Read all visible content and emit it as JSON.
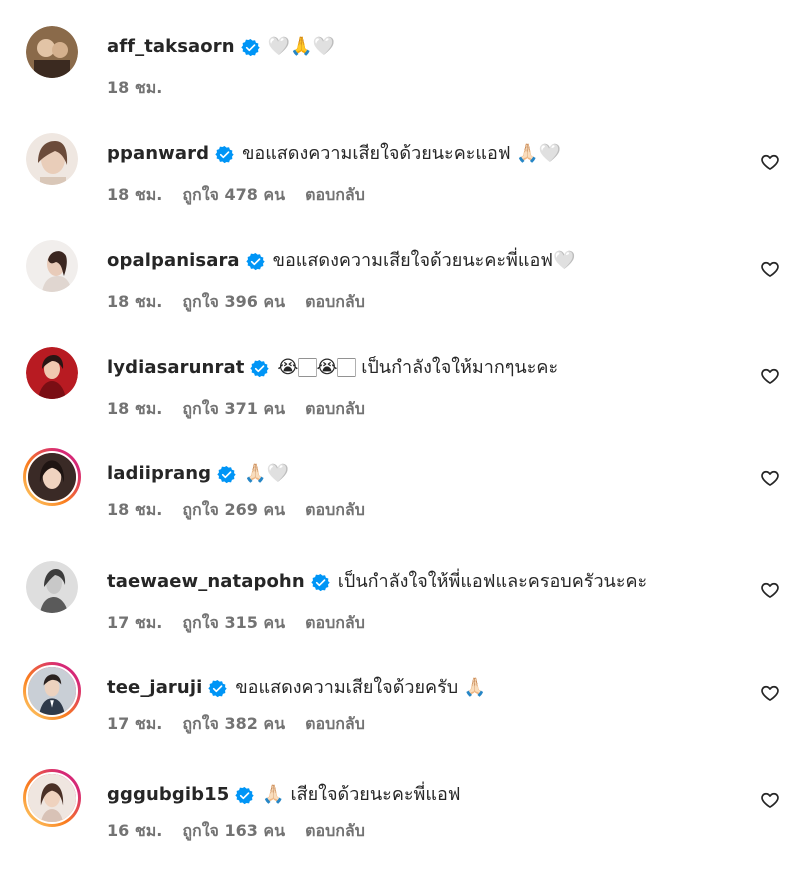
{
  "comments": [
    {
      "username": "aff_taksaorn",
      "text": "🤍🙏🤍",
      "time": "18 ชม.",
      "likes": "",
      "reply": "",
      "has_like_button": false,
      "story_ring": false,
      "avatar_color": "#8a6a4a"
    },
    {
      "username": "ppanward",
      "text": "ขอแสดงความเสียใจด้วยนะคะแอฟ 🙏🏻🤍",
      "time": "18 ชม.",
      "likes": "ถูกใจ 478 คน",
      "reply": "ตอบกลับ",
      "has_like_button": true,
      "story_ring": false,
      "avatar_color": "#d9c7b8"
    },
    {
      "username": "opalpanisara",
      "text": "ขอแสดงความเสียใจด้วยนะคะพี่แอฟ🤍",
      "time": "18 ชม.",
      "likes": "ถูกใจ 396 คน",
      "reply": "ตอบกลับ",
      "has_like_button": true,
      "story_ring": false,
      "avatar_color": "#e8e0dc"
    },
    {
      "username": "lydiasarunrat",
      "text": "😭🏻😭🏻 เป็นกำลังใจให้มากๆนะคะ",
      "time": "18 ชม.",
      "likes": "ถูกใจ 371 คน",
      "reply": "ตอบกลับ",
      "has_like_button": true,
      "story_ring": false,
      "avatar_color": "#b81b22"
    },
    {
      "username": "ladiiprang",
      "text": "🙏🏻🤍",
      "time": "18 ชม.",
      "likes": "ถูกใจ 269 คน",
      "reply": "ตอบกลับ",
      "has_like_button": true,
      "story_ring": true,
      "avatar_color": "#3a2a26"
    },
    {
      "username": "taewaew_natapohn",
      "text": "เป็นกำลังใจให้พี่แอฟและครอบครัวนะคะ",
      "time": "17 ชม.",
      "likes": "ถูกใจ 315 คน",
      "reply": "ตอบกลับ",
      "has_like_button": true,
      "story_ring": false,
      "avatar_color": "#cfcfcf"
    },
    {
      "username": "tee_jaruji",
      "text": "ขอแสดงความเสียใจด้วยครับ 🙏🏻",
      "time": "17 ชม.",
      "likes": "ถูกใจ 382 คน",
      "reply": "ตอบกลับ",
      "has_like_button": true,
      "story_ring": true,
      "avatar_color": "#4b5a6e"
    },
    {
      "username": "gggubgib15",
      "text": "🙏🏻 เสียใจด้วยนะคะพี่แอฟ",
      "time": "16 ชม.",
      "likes": "ถูกใจ 163 คน",
      "reply": "ตอบกลับ",
      "has_like_button": true,
      "story_ring": true,
      "avatar_color": "#d8c2b6"
    }
  ],
  "colors": {
    "verified": "#0095f6",
    "secondary_text": "#737373",
    "ring_start": "#feda75",
    "ring_mid": "#fa7e1e",
    "ring_end": "#d62976"
  },
  "icons": {
    "verified": "verified-badge-icon",
    "like": "heart-outline-icon"
  }
}
